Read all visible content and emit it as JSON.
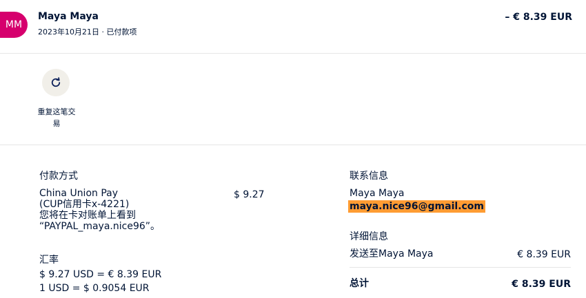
{
  "header": {
    "avatar_initials": "MM",
    "avatar_color": "#d6006d",
    "payee_name": "Maya Maya",
    "meta": "2023年10月21日 · 已付款项",
    "amount": "– € 8.39 EUR"
  },
  "actions": {
    "repeat_icon": "refresh-icon",
    "repeat_label": "重复这笔交易"
  },
  "payment": {
    "title": "付款方式",
    "method_line1": "China Union Pay",
    "method_line2": "(CUP信用卡x-4221)",
    "method_line3": "您将在卡对账单上看到",
    "method_line4": "“PAYPAL_maya.nice96”。",
    "amount": "$ 9.27"
  },
  "exchange": {
    "title": "汇率",
    "line1": "$ 9.27 USD = € 8.39 EUR",
    "line2": "1 USD = $ 0.9054 EUR"
  },
  "contact": {
    "title": "联系信息",
    "name": "Maya Maya",
    "email": "maya.nice96@gmail.com"
  },
  "details": {
    "title": "详细信息",
    "sent_to": "发送至Maya Maya",
    "sent_amount": "€ 8.39 EUR",
    "total_label": "总计",
    "total_amount": "€ 8.39 EUR"
  }
}
